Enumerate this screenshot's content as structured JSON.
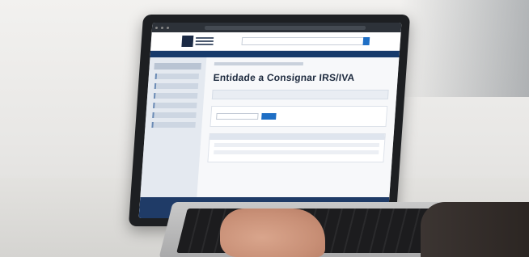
{
  "page": {
    "heading": "Entidade a Consignar IRS/IVA"
  }
}
